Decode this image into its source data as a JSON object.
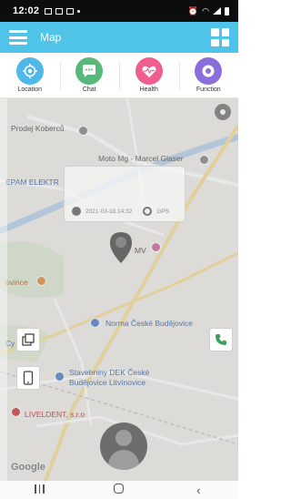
{
  "status_bar": {
    "time": "12:02"
  },
  "header": {
    "title": "Map"
  },
  "functions": [
    {
      "label": "Location",
      "color": "#4fb8e8",
      "icon": "location-icon"
    },
    {
      "label": "Chat",
      "color": "#57b879",
      "icon": "chat-icon"
    },
    {
      "label": "Health",
      "color": "#f05d8f",
      "icon": "heart-icon"
    },
    {
      "label": "Function",
      "color": "#8a6fdc",
      "icon": "function-icon"
    }
  ],
  "map": {
    "labels": {
      "prodej_koberco": "Prodej Koberců",
      "moto_mg": "Moto Mg - Marcel Glaser",
      "epam": "EPAM ELEKTR",
      "mv": "MV",
      "dvince": "ovince",
      "norma": "Norma České Budějovice",
      "cy_ecka": "Cy  ecka",
      "stavebniny_1": "Stavebniny DEK České",
      "stavebniny_2": "Budějovice Litvínovice",
      "livedent": "LIVELDENT, s.r.o"
    },
    "info_card": {
      "time": "2021-03-18 14:32",
      "source": "GPS"
    },
    "google": "Google"
  },
  "colors": {
    "header": "#4fc3e8",
    "overlay": "#969696"
  }
}
